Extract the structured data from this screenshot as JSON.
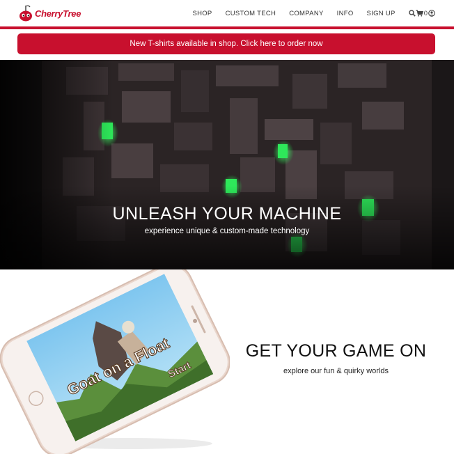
{
  "brand": {
    "name": "CherryTree",
    "accent": "#c8102e"
  },
  "nav": {
    "items": [
      {
        "label": "SHOP"
      },
      {
        "label": "CUSTOM TECH"
      },
      {
        "label": "COMPANY"
      },
      {
        "label": "INFO"
      },
      {
        "label": "SIGN UP"
      }
    ],
    "icons": [
      "search-icon",
      "cart-icon",
      "user-icon"
    ],
    "cart_count": "0"
  },
  "banner": {
    "text": "New T-shirts available in shop. Click here to order now"
  },
  "hero": {
    "title": "UNLEASH YOUR MACHINE",
    "subtitle": "experience unique & custom-made technology"
  },
  "game": {
    "title": "GET YOUR GAME ON",
    "subtitle": "explore our fun & quirky worlds",
    "screen_title": "Goat on a Float",
    "start_label": "Start"
  }
}
